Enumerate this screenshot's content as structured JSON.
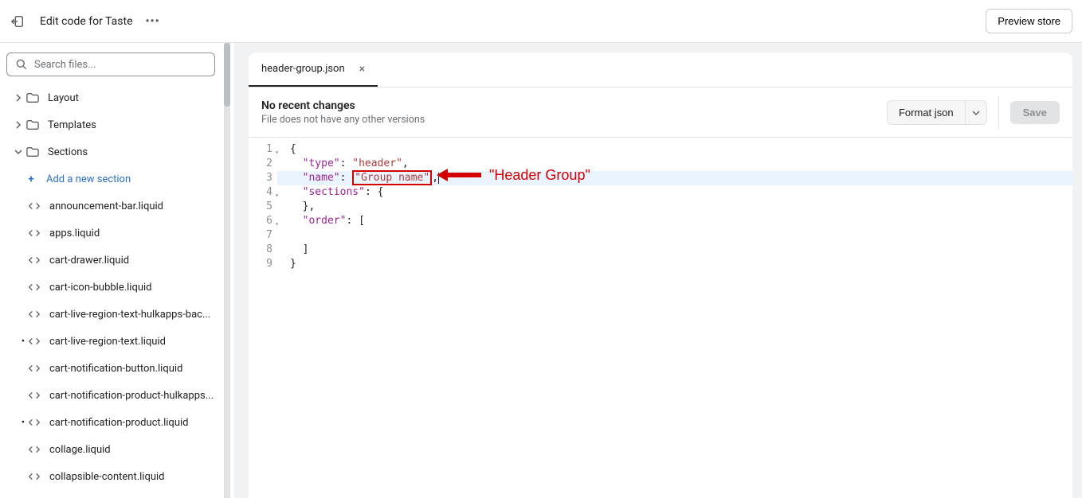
{
  "topbar": {
    "title": "Edit code for Taste",
    "preview_label": "Preview store"
  },
  "sidebar": {
    "search_placeholder": "Search files...",
    "folders": {
      "layout": "Layout",
      "templates": "Templates",
      "sections": "Sections"
    },
    "add_section_label": "Add a new section",
    "files": [
      "announcement-bar.liquid",
      "apps.liquid",
      "cart-drawer.liquid",
      "cart-icon-bubble.liquid",
      "cart-live-region-text-hulkapps-bac...",
      "cart-live-region-text.liquid",
      "cart-notification-button.liquid",
      "cart-notification-product-hulkapps...",
      "cart-notification-product.liquid",
      "collage.liquid",
      "collapsible-content.liquid"
    ],
    "modified_indices": [
      5,
      8
    ]
  },
  "editor": {
    "tab_name": "header-group.json",
    "status_title": "No recent changes",
    "status_sub": "File does not have any other versions",
    "format_label": "Format json",
    "save_label": "Save",
    "code_lines": [
      {
        "n": 1,
        "fold": true
      },
      {
        "n": 2
      },
      {
        "n": 3
      },
      {
        "n": 4,
        "fold": true
      },
      {
        "n": 5
      },
      {
        "n": 6,
        "fold": true
      },
      {
        "n": 7
      },
      {
        "n": 8
      },
      {
        "n": 9
      }
    ],
    "tokens": {
      "l1": "{",
      "l2_key": "\"type\"",
      "l2_sep": ": ",
      "l2_val": "\"header\"",
      "l2_end": ",",
      "l3_key": "\"name\"",
      "l3_sep": ": ",
      "l3_val": "\"Group name\"",
      "l3_end": ",",
      "l4_key": "\"sections\"",
      "l4_sep": ": ",
      "l4_val": "{",
      "l5": "},",
      "l6_key": "\"order\"",
      "l6_sep": ": ",
      "l6_val": "[",
      "l7": "",
      "l8": "]",
      "l9": "}"
    },
    "annotation_text": "\"Header Group\""
  }
}
